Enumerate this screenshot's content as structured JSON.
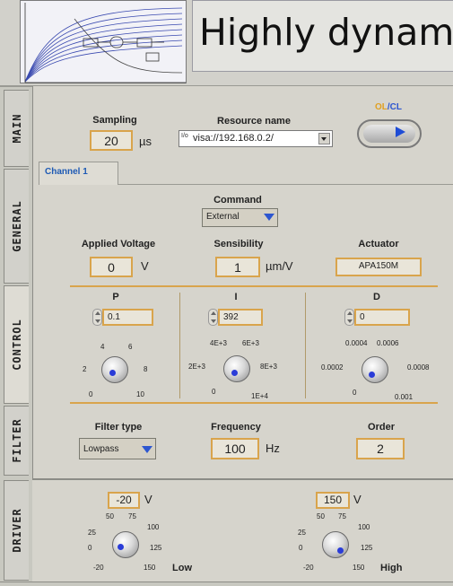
{
  "header": {
    "title": "Highly dynam"
  },
  "tabs": [
    "MAIN",
    "GENERAL",
    "CONTROL",
    "FILTER",
    "DRIVER"
  ],
  "main": {
    "sampling": {
      "label": "Sampling",
      "value": "20",
      "unit": "µs"
    },
    "resource": {
      "label": "Resource name",
      "value": "visa://192.168.0.2/",
      "icon_text": "I/o"
    },
    "mode": {
      "ol": "OL",
      "slash": "/",
      "cl": "CL"
    },
    "channel_tab": "Channel 1"
  },
  "channel": {
    "command": {
      "label": "Command",
      "value": "External"
    },
    "applied_voltage": {
      "label": "Applied Voltage",
      "value": "0",
      "unit": "V"
    },
    "sensibility": {
      "label": "Sensibility",
      "value": "1",
      "unit": "µm/V"
    },
    "actuator": {
      "label": "Actuator",
      "value": "APA150M"
    },
    "pid": {
      "p": {
        "label": "P",
        "value": "0.1",
        "ticks": [
          "4",
          "6",
          "2",
          "8",
          "0",
          "10"
        ]
      },
      "i": {
        "label": "I",
        "value": "392",
        "ticks": [
          "4E+3",
          "6E+3",
          "2E+3",
          "8E+3",
          "0",
          "1E+4"
        ]
      },
      "d": {
        "label": "D",
        "value": "0",
        "ticks": [
          "0.0004",
          "0.0006",
          "0.0002",
          "0.0008",
          "0",
          "0.001"
        ]
      }
    },
    "filter_type": {
      "label": "Filter type",
      "value": "Lowpass"
    },
    "frequency": {
      "label": "Frequency",
      "value": "100",
      "unit": "Hz"
    },
    "order": {
      "label": "Order",
      "value": "2"
    }
  },
  "driver": {
    "low": {
      "value": "-20",
      "unit": "V",
      "label": "Low",
      "ticks": [
        "50",
        "75",
        "25",
        "100",
        "0",
        "125",
        "-20",
        "150"
      ]
    },
    "high": {
      "value": "150",
      "unit": "V",
      "label": "High",
      "ticks": [
        "50",
        "75",
        "25",
        "100",
        "0",
        "125",
        "-20",
        "150"
      ]
    }
  },
  "colors": {
    "accent_blue": "#2d56d0",
    "frame_orange": "#d9a44c",
    "panel": "#d6d4cc"
  }
}
